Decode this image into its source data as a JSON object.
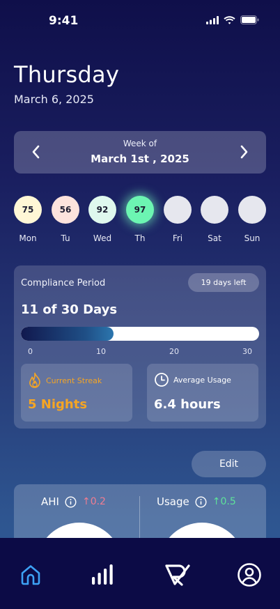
{
  "status_bar": {
    "time": "9:41"
  },
  "header": {
    "day": "Thursday",
    "date": "March 6, 2025"
  },
  "week": {
    "label": "Week of",
    "date": "March 1st , 2025"
  },
  "days": [
    {
      "label": "Mon",
      "score": "75",
      "color": "#fff7d6"
    },
    {
      "label": "Tu",
      "score": "56",
      "color": "#fde3dd"
    },
    {
      "label": "Wed",
      "score": "92",
      "color": "#dff8ee"
    },
    {
      "label": "Th",
      "score": "97",
      "color": "#6cf5b2"
    },
    {
      "label": "Fri",
      "score": "",
      "color": "#e6e7ee"
    },
    {
      "label": "Sat",
      "score": "",
      "color": "#e6e7ee"
    },
    {
      "label": "Sun",
      "score": "",
      "color": "#e6e7ee"
    }
  ],
  "compliance": {
    "title": "Compliance Period",
    "days_left": "19 days left",
    "progress_text": "11 of 30 Days",
    "progress": 0.39,
    "ticks": [
      "0",
      "10",
      "20",
      "30"
    ],
    "streak_label": "Current Streak",
    "streak_value": "5 Nights",
    "usage_label": "Average Usage",
    "usage_value": "6.4 hours"
  },
  "edit_label": "Edit",
  "metrics": {
    "ahi": {
      "label": "AHI",
      "delta": "↑0.2",
      "color": "#f07d92"
    },
    "usage": {
      "label": "Usage",
      "delta": "↑0.5",
      "color": "#5ee39a"
    }
  },
  "colors": {
    "streak": "#f5a524",
    "tab_active": "#3da2f5"
  },
  "tabs": [
    "home-icon",
    "stats-icon",
    "logo-icon",
    "profile-icon"
  ]
}
